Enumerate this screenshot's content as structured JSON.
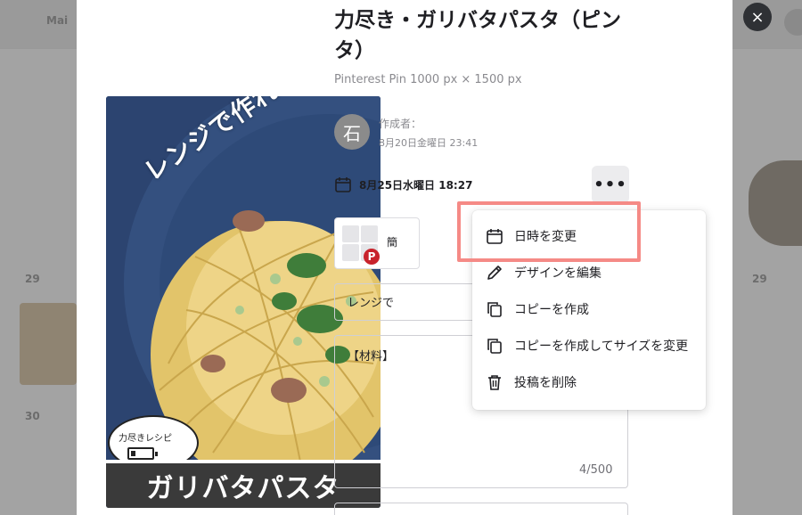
{
  "background": {
    "tab_label": "Mai",
    "row_labels": [
      "29",
      "30"
    ],
    "right_labels": [
      "29"
    ]
  },
  "modal": {
    "title": "力尽き・ガリバタパスタ（ピンタ）",
    "subtitle": "Pinterest Pin 1000 px × 1500 px",
    "creator": {
      "avatar_initial": "石",
      "label": "作成者：",
      "date": "8月20日金曜日 23:41"
    },
    "schedule": {
      "date": "8月25日水曜日 18:27",
      "more_label": "•••"
    },
    "pin_account": {
      "label": "簡",
      "logo": "P"
    },
    "title_field": {
      "value": "レンジで"
    },
    "description_field": {
      "value": "【材料】",
      "char_count": "4/500"
    },
    "close_label": "×"
  },
  "design": {
    "handwritten_title": "レンジで作れる",
    "bubble_text": "力尽きレシピ",
    "banner_text": "ガリバタパスタ"
  },
  "menu": {
    "items": [
      {
        "label": "日時を変更",
        "icon": "calendar-icon"
      },
      {
        "label": "デザインを編集",
        "icon": "pencil-icon"
      },
      {
        "label": "コピーを作成",
        "icon": "copy-icon"
      },
      {
        "label": "コピーを作成してサイズを変更",
        "icon": "copy-resize-icon"
      },
      {
        "label": "投稿を削除",
        "icon": "trash-icon"
      }
    ]
  },
  "colors": {
    "highlight": "#f58a86",
    "overlay": "#a3a3a3",
    "close_button": "#2f3135",
    "pinterest_red": "#c8232c"
  }
}
